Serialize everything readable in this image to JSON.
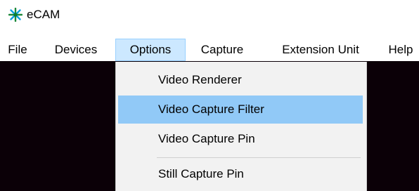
{
  "window": {
    "title": "eCAM",
    "icon": "ecam-starburst-icon",
    "icon_colors": [
      "#00a8e8",
      "#1f7a1f"
    ]
  },
  "menubar": {
    "items": [
      {
        "label": "File"
      },
      {
        "label": "Devices"
      },
      {
        "label": "Options",
        "active": true
      },
      {
        "label": "Capture"
      },
      {
        "label": "Extension Unit"
      },
      {
        "label": "Help"
      }
    ]
  },
  "options_menu": {
    "items": [
      {
        "label": "Video Renderer"
      },
      {
        "label": "Video Capture Filter",
        "highlighted": true
      },
      {
        "label": "Video Capture Pin"
      },
      {
        "label": "Still Capture Pin"
      }
    ]
  },
  "colors": {
    "menu_active_bg": "#cce8ff",
    "menu_active_border": "#99d1ff",
    "dropdown_bg": "#f2f2f2",
    "item_highlight_bg": "#91c9f7",
    "video_bg": "#0b0007"
  }
}
